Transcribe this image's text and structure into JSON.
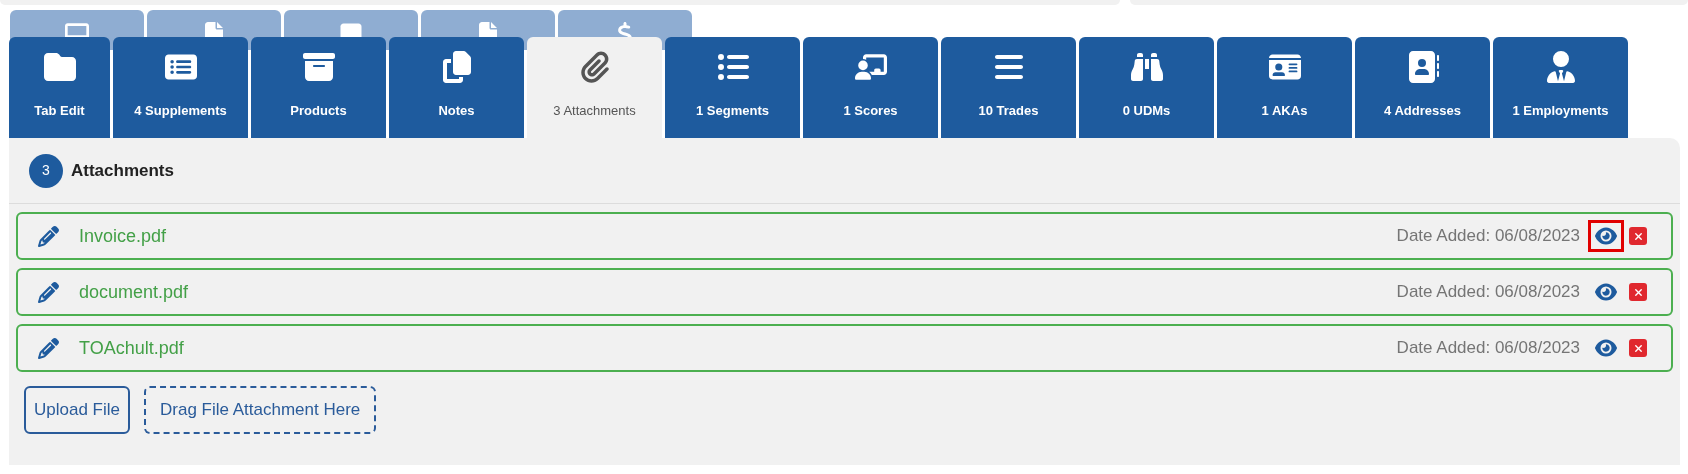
{
  "tabs": [
    {
      "label": "Tab Edit",
      "selected": false
    },
    {
      "label": "4 Supplements",
      "selected": false
    },
    {
      "label": "Products",
      "selected": false
    },
    {
      "label": "Notes",
      "selected": false
    },
    {
      "label": "3 Attachments",
      "selected": true
    },
    {
      "label": "1 Segments",
      "selected": false
    },
    {
      "label": "1 Scores",
      "selected": false
    },
    {
      "label": "10 Trades",
      "selected": false
    },
    {
      "label": "0 UDMs",
      "selected": false
    },
    {
      "label": "1 AKAs",
      "selected": false
    },
    {
      "label": "4 Addresses",
      "selected": false
    },
    {
      "label": "1 Employments",
      "selected": false
    }
  ],
  "section": {
    "count": "3",
    "title": "Attachments"
  },
  "attachments": [
    {
      "name": "Invoice.pdf",
      "date": "Date Added: 06/08/2023",
      "highlighted": true
    },
    {
      "name": "document.pdf",
      "date": "Date Added: 06/08/2023",
      "highlighted": false
    },
    {
      "name": "TOAchult.pdf",
      "date": "Date Added: 06/08/2023",
      "highlighted": false
    }
  ],
  "buttons": {
    "upload": "Upload File",
    "drop": "Drag File Attachment Here"
  }
}
